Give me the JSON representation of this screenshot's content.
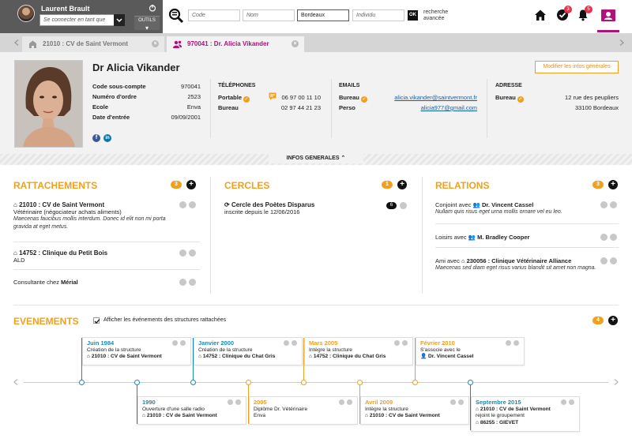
{
  "topbar": {
    "user_name": "Laurent Brault",
    "connect_placeholder": "Se connecter en tant que",
    "tools_label": "OUTILS",
    "search": {
      "code_placeholder": "Code",
      "nom_placeholder": "Nom",
      "city_value": "Bordeaux",
      "individu_placeholder": "Individu",
      "ok_label": "OK",
      "advanced_line1": "recherche",
      "advanced_line2": "avancée"
    },
    "tasks_badge": "3",
    "notifications_badge": "5",
    "accent_color": "#b0117b"
  },
  "tabs": [
    {
      "label": "21010 : CV de Saint Vermont",
      "icon": "structure-icon",
      "active": false
    },
    {
      "label": "970041 : Dr. Alicia Vikander",
      "icon": "person-icon",
      "active": true
    }
  ],
  "profile": {
    "name": "Dr Alicia Vikander",
    "edit_label": "Modifier les infos générales",
    "fields": [
      {
        "label": "Code sous-compte",
        "value": "970041"
      },
      {
        "label": "Numéro d'ordre",
        "value": "2523"
      },
      {
        "label": "Ecole",
        "value": "Enva"
      },
      {
        "label": "Date d'entrée",
        "value": "09/09/2001"
      }
    ],
    "phones": {
      "title": "TÉLÉPHONES",
      "items": [
        {
          "label": "Portable",
          "value": "06 97 00 11 10"
        },
        {
          "label": "Bureau",
          "value": "02 97 44 21 23"
        }
      ]
    },
    "emails": {
      "title": "EMAILS",
      "items": [
        {
          "label": "Bureau",
          "value": "alicia.vikander@saintvermont.fr"
        },
        {
          "label": "Perso",
          "value": "alicia977@gmail.com"
        }
      ]
    },
    "address": {
      "title": "ADRESSE",
      "label": "Bureau",
      "line1": "12 rue des peupliers",
      "line2": "33100 Bordeaux"
    },
    "social": {
      "facebook": "f",
      "linkedin": "in"
    },
    "toggle_label": "INFOS GENERALES"
  },
  "rattachements": {
    "title": "RATTACHEMENTS",
    "count": "3",
    "items": [
      {
        "title": "21010 : CV de Saint Vermont",
        "sub": "Vétérinaire (négociateur achats aliments)",
        "note": "Maecenas faucibus mollis interdum. Donec id elit non mi porta gravida at eget metus."
      },
      {
        "title": "14752 : Clinique du Petit Bois",
        "sub": "ALD",
        "note": ""
      },
      {
        "prefix": "Consultante chez ",
        "bold": "Mérial"
      }
    ]
  },
  "cercles": {
    "title": "CERCLES",
    "count": "1",
    "items": [
      {
        "title": "Cercle des Poètes Disparus",
        "sub": "inscrite depuis le 12/06/2016",
        "members": "6"
      }
    ]
  },
  "relations": {
    "title": "RELATIONS",
    "count": "3",
    "items": [
      {
        "prefix": "Conjoint avec",
        "name": "Dr. Vincent Cassel",
        "note": "Nullam quis risus eget urna mollis ornare vel eu leo."
      },
      {
        "prefix": "Loisirs avec",
        "name": "M. Bradley Cooper",
        "note": ""
      },
      {
        "prefix": "Ami avec",
        "name": "230056 : Clinique Vétérinaire Alliance",
        "note": "Maecenas sed diam eget risus varius blandit sit amet non magna."
      }
    ]
  },
  "evenements": {
    "title": "EVENEMENTS",
    "count": "4",
    "checkbox_label": "Afficher les événements des structures rattachées",
    "events": [
      {
        "date": "Juin 1984",
        "text": "Création de la structure",
        "ref": "21010 : CV de Saint Vermont",
        "color": "blue"
      },
      {
        "date": "1990",
        "text": "Ouverture d'une salle radio",
        "ref": "21010 : CV de Saint Vermont",
        "color": "blue"
      },
      {
        "date": "Janvier 2000",
        "text": "Création de la structure",
        "ref": "14752 : Clinique du Chat Gris",
        "color": "blue"
      },
      {
        "date": "2005",
        "text": "Diplôme Dr. Vétérinaire",
        "ref": "Enva",
        "color": "orange"
      },
      {
        "date": "Mars 2005",
        "text": "Intègre la structure",
        "ref": "14752 : Clinique du Chat Gris",
        "color": "orange"
      },
      {
        "date": "Avril 2009",
        "text": "Intègre la structure",
        "ref": "21010 : CV de Saint Vermont",
        "color": "orange"
      },
      {
        "date": "Février 2010",
        "text": "S'associe avec le",
        "ref": "Dr. Vincent Cassel",
        "color": "orange"
      },
      {
        "date": "Septembre 2015",
        "text": "21010 : CV de Saint Vermont",
        "text2": "rejoint le groupement",
        "ref": "86255 : GIEVET",
        "color": "blue"
      }
    ]
  },
  "colors": {
    "orange": "#f0a020",
    "blue": "#1d8ab0",
    "magenta": "#b0117b"
  }
}
